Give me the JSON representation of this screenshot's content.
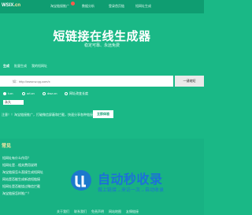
{
  "nav": {
    "logo_text": "WSIX",
    "logo_domain": ".cn",
    "items": [
      "淘宝链接推广",
      "数据分析",
      "登录首页链",
      "短网址生成"
    ]
  },
  "hero": {
    "title": "短链接在线生成器",
    "subtitle": "稳定可靠、永远免费"
  },
  "tabs": [
    "生成",
    "批量生成",
    "我的短网址"
  ],
  "url_input": {
    "placeholder": "如：http://www.w.qq.com/x",
    "button": "一键缩短"
  },
  "domain_options": [
    {
      "label": "t.cn",
      "checked": true
    },
    {
      "label": "url.cn",
      "checked": false
    },
    {
      "label": "dwz.cn",
      "checked": false
    },
    {
      "label": "网址改变长度",
      "checked": false
    }
  ],
  "expiry_select": "永久",
  "notice": {
    "text": "注意！！淘宝链接推广，打破微信屏蔽和拦截，快速分享各种链接",
    "button": "立即体验"
  },
  "faq": {
    "title": "常见",
    "items": [
      "短网址有什么作用？",
      "短网址是…相关费用说明",
      "淘宝链接怎么直接生成短网址",
      "网站是否能生成新浪短链接",
      "短网址是否能绕过微信拦截",
      "淘宝链接怎样推广？"
    ],
    "footer_links": [
      "关于我们",
      "联系我们",
      "免责声明",
      "网站地图",
      "友情链接"
    ]
  },
  "watermark": {
    "title": "自动秒收录",
    "subtitle": "做上链接→来访一次→自动收录",
    "color": "#1d6fd9"
  }
}
